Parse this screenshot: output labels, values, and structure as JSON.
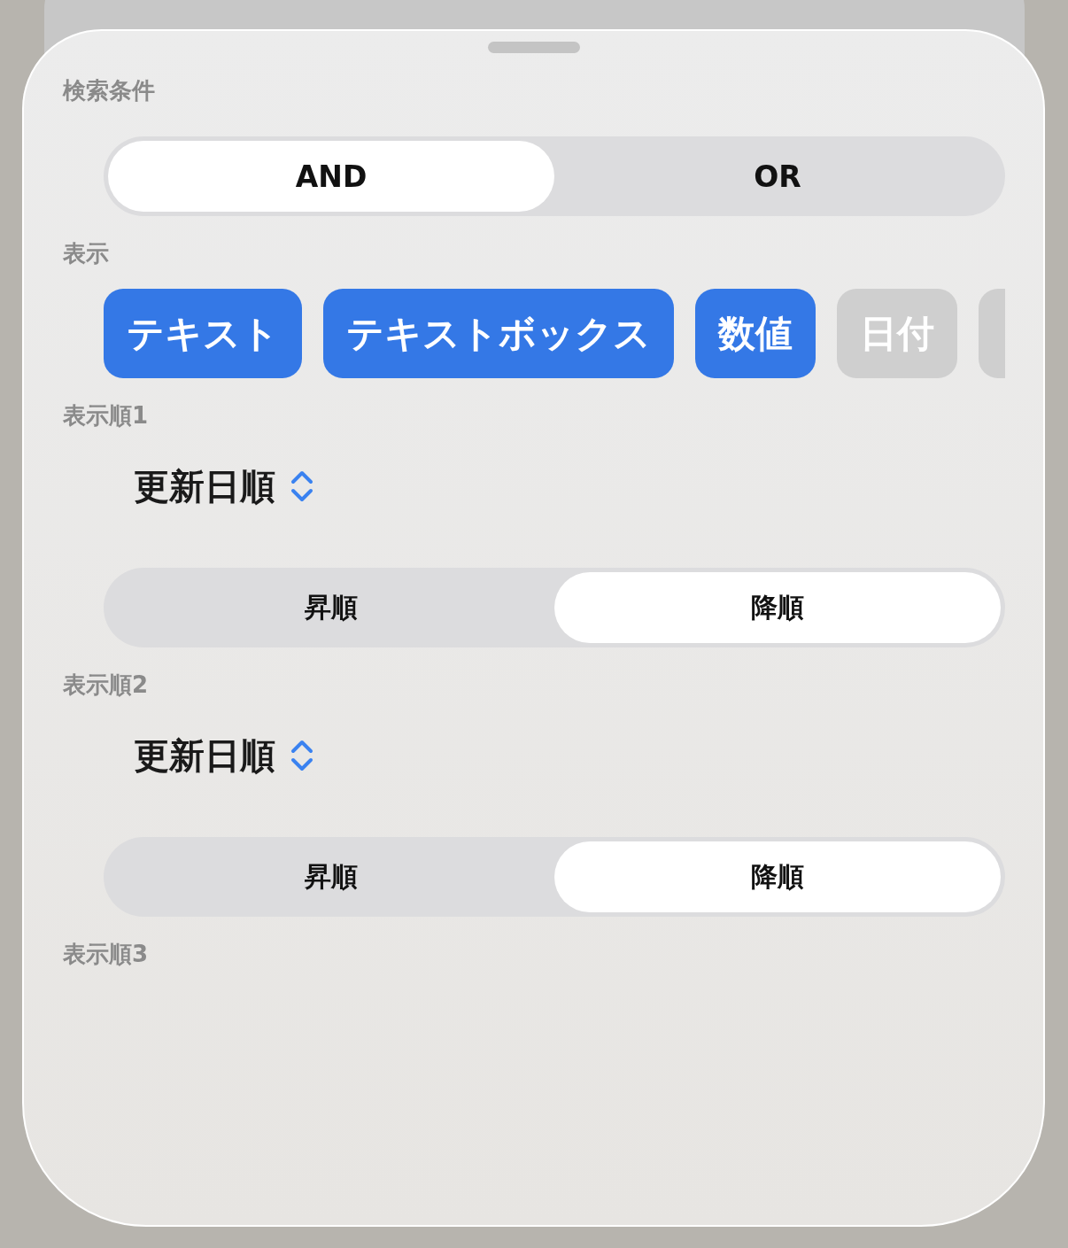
{
  "sections": [
    {
      "kind": "segmented",
      "label": "検索条件",
      "options": [
        {
          "label": "AND",
          "selected": true
        },
        {
          "label": "OR",
          "selected": false
        }
      ]
    },
    {
      "kind": "chips",
      "label": "表示",
      "chips": [
        {
          "label": "テキスト",
          "selected": true
        },
        {
          "label": "テキストボックス",
          "selected": true
        },
        {
          "label": "数値",
          "selected": true
        },
        {
          "label": "日付",
          "selected": false
        },
        {
          "selected": false
        }
      ]
    },
    {
      "kind": "sort",
      "label": "表示順1",
      "picker": "更新日順",
      "options": [
        {
          "label": "昇順",
          "selected": false
        },
        {
          "label": "降順",
          "selected": true
        }
      ]
    },
    {
      "kind": "sort",
      "label": "表示順2",
      "picker": "更新日順",
      "options": [
        {
          "label": "昇順",
          "selected": false
        },
        {
          "label": "降順",
          "selected": true
        }
      ]
    },
    {
      "kind": "sort",
      "label": "表示順3"
    }
  ]
}
